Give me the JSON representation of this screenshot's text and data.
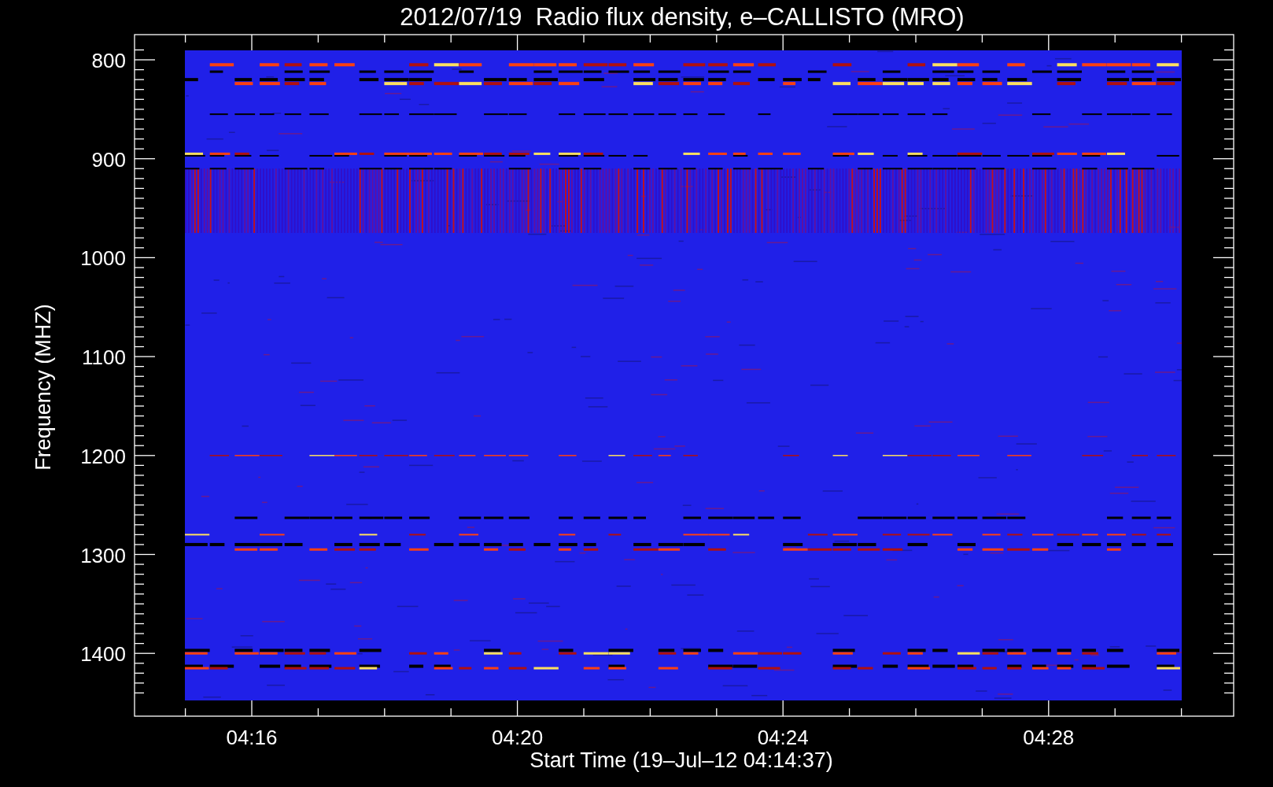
{
  "title": "2012/07/19  Radio flux density, e–CALLISTO (MRO)",
  "y_axis": {
    "label": "Frequency (MHZ)",
    "ticks": [
      "800",
      "900",
      "1000",
      "1100",
      "1200",
      "1300",
      "1400"
    ]
  },
  "x_axis": {
    "label": "Start Time (19–Jul–12 04:14:37)",
    "ticks": [
      "04:16",
      "04:20",
      "04:24",
      "04:28"
    ]
  }
}
